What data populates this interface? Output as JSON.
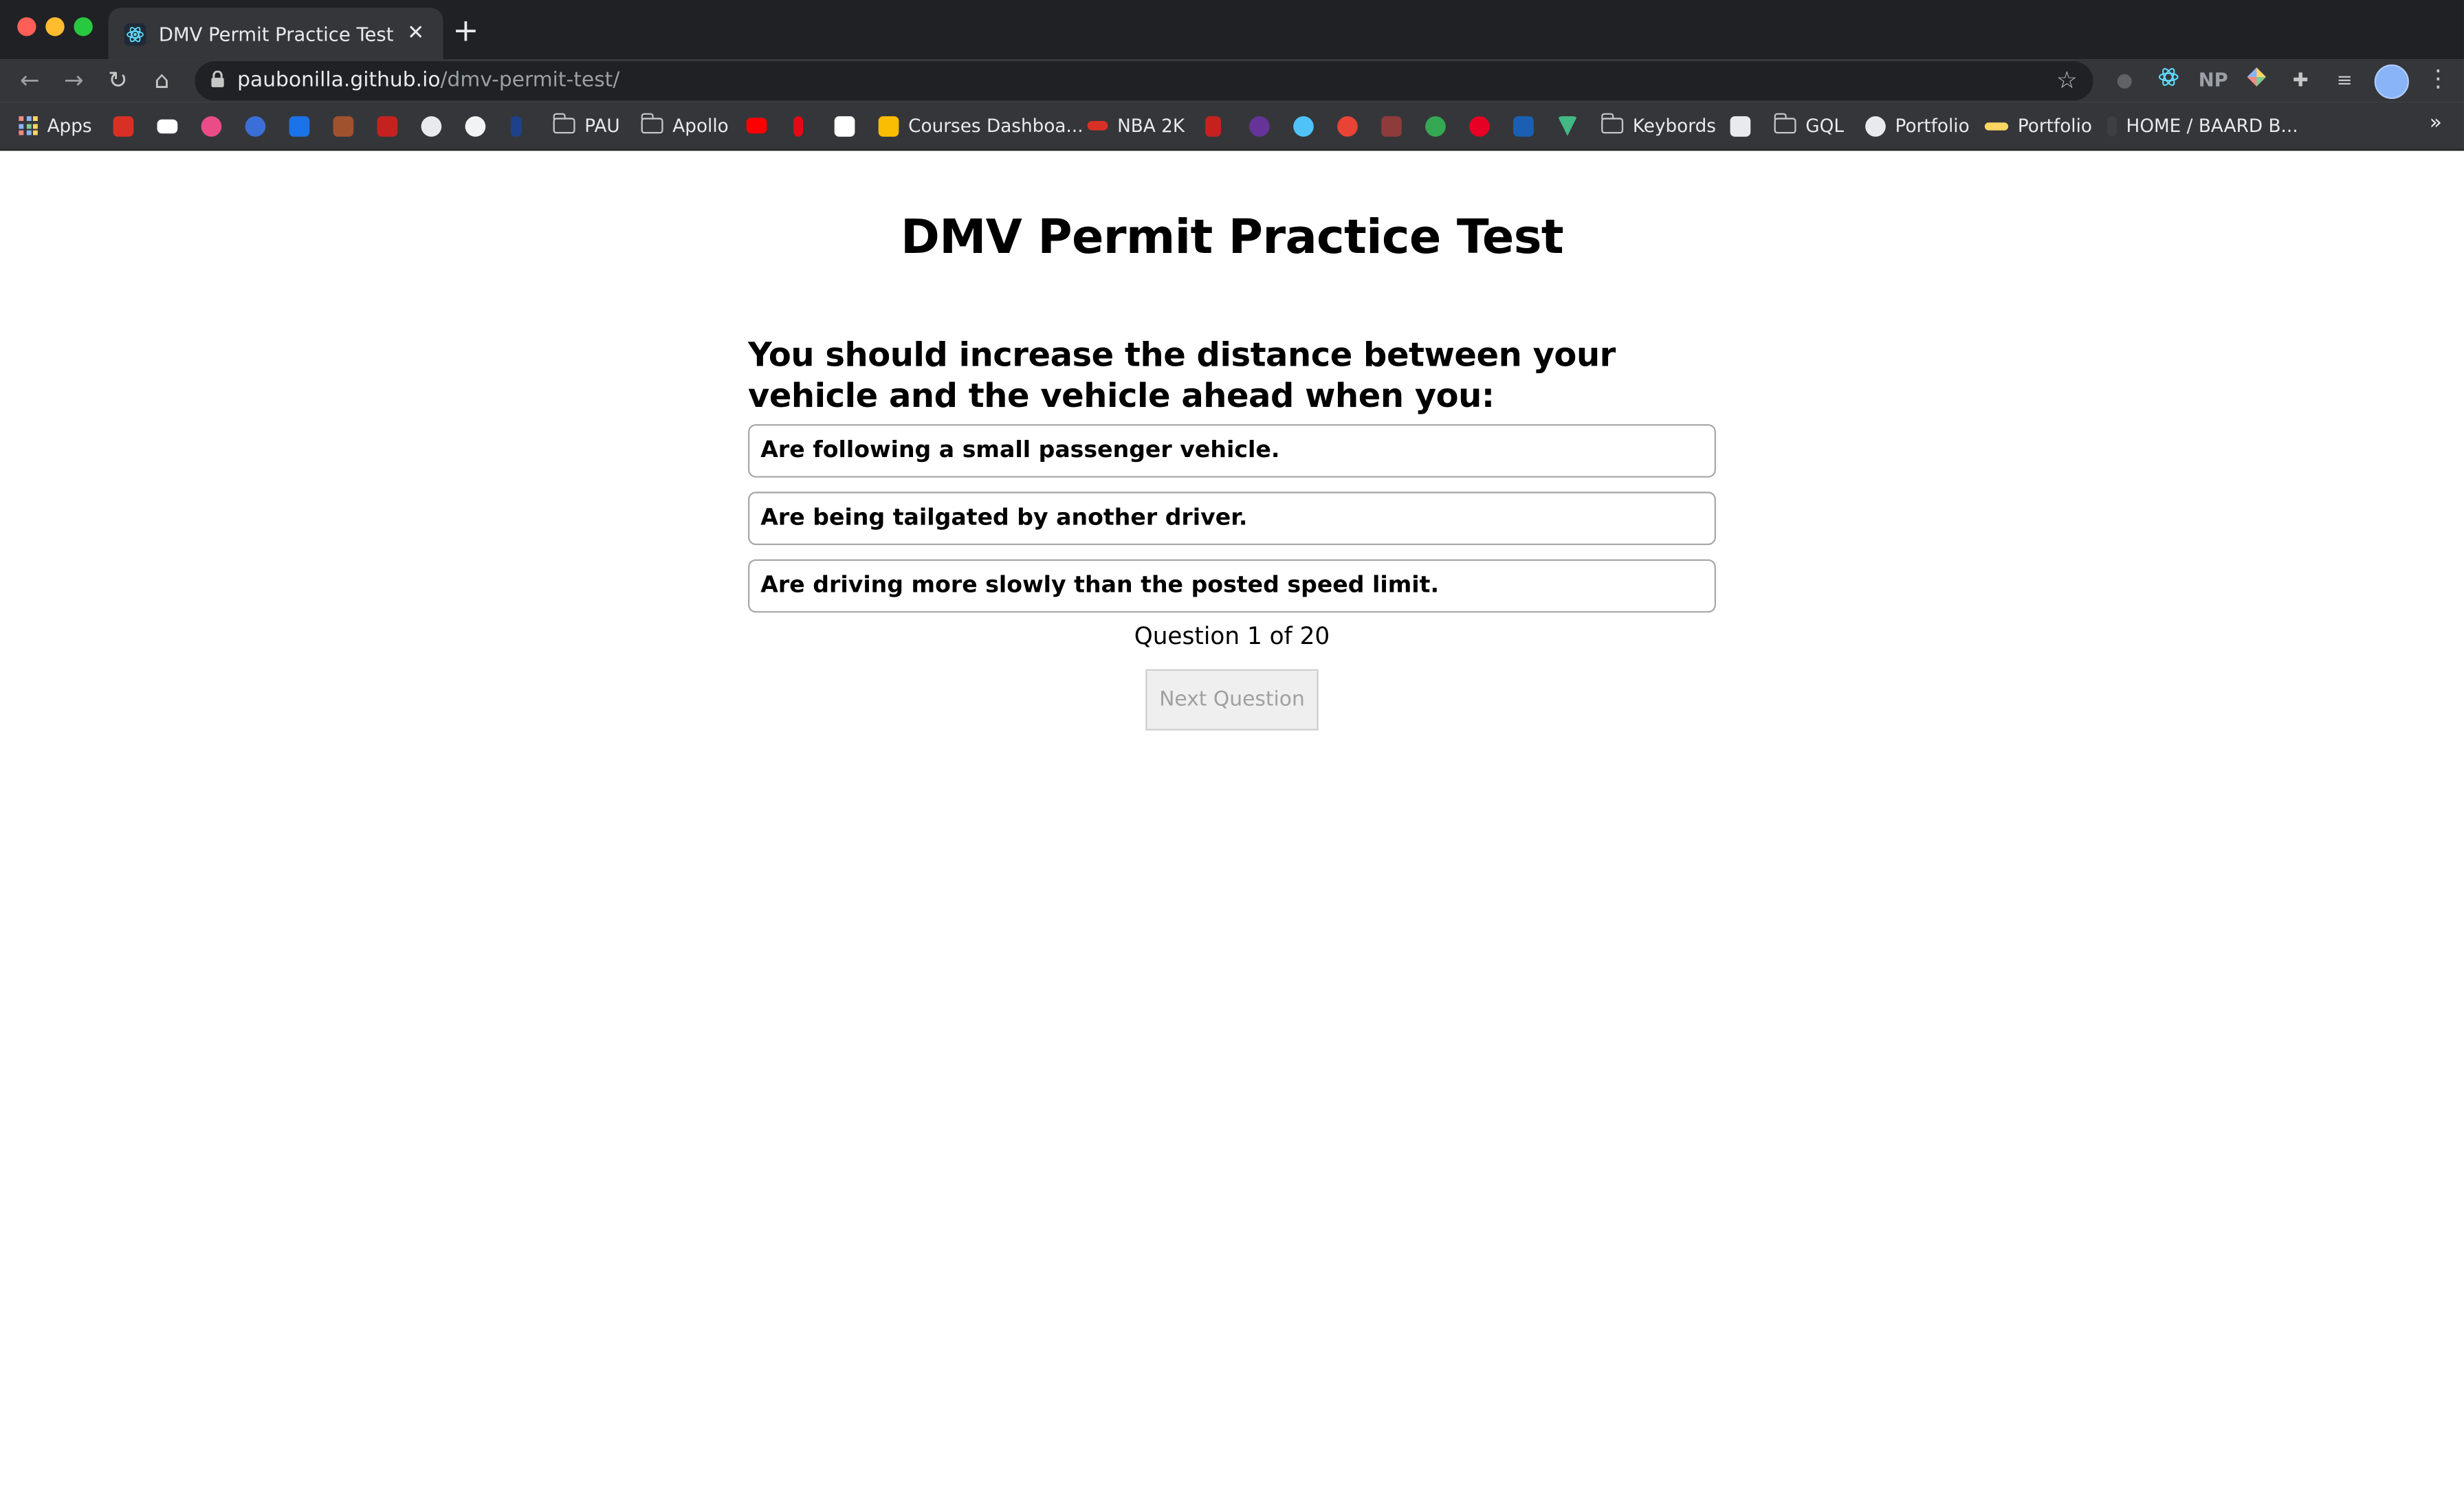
{
  "browser": {
    "tab_title": "DMV Permit Practice Test",
    "tab_close": "✕",
    "new_tab": "+",
    "url_host": "paubonilla.github.io",
    "url_path": "/dmv-permit-test/",
    "ext_np": "NP",
    "bookmarks": {
      "apps": "Apps",
      "pau": "PAU",
      "apollo": "Apollo",
      "courses": "Courses Dashboa...",
      "nba": "NBA 2K",
      "keybords": "Keybords",
      "gql": "GQL",
      "portfolio1": "Portfolio",
      "portfolio2": "Portfolio",
      "home": "HOME / BAARD B..."
    }
  },
  "page": {
    "title": "DMV Permit Practice Test",
    "question": "You should increase the distance between your vehicle and the vehicle ahead when you:",
    "answers": [
      "Are following a small passenger vehicle.",
      "Are being tailgated by another driver.",
      "Are driving more slowly than the posted speed limit."
    ],
    "progress": "Question 1 of 20",
    "next_button": "Next Question"
  },
  "colors": {
    "chrome_dark": "#202124",
    "chrome_toolbar": "#35363a",
    "answer_border": "#a9a9a9",
    "disabled_button": "#efefef"
  }
}
